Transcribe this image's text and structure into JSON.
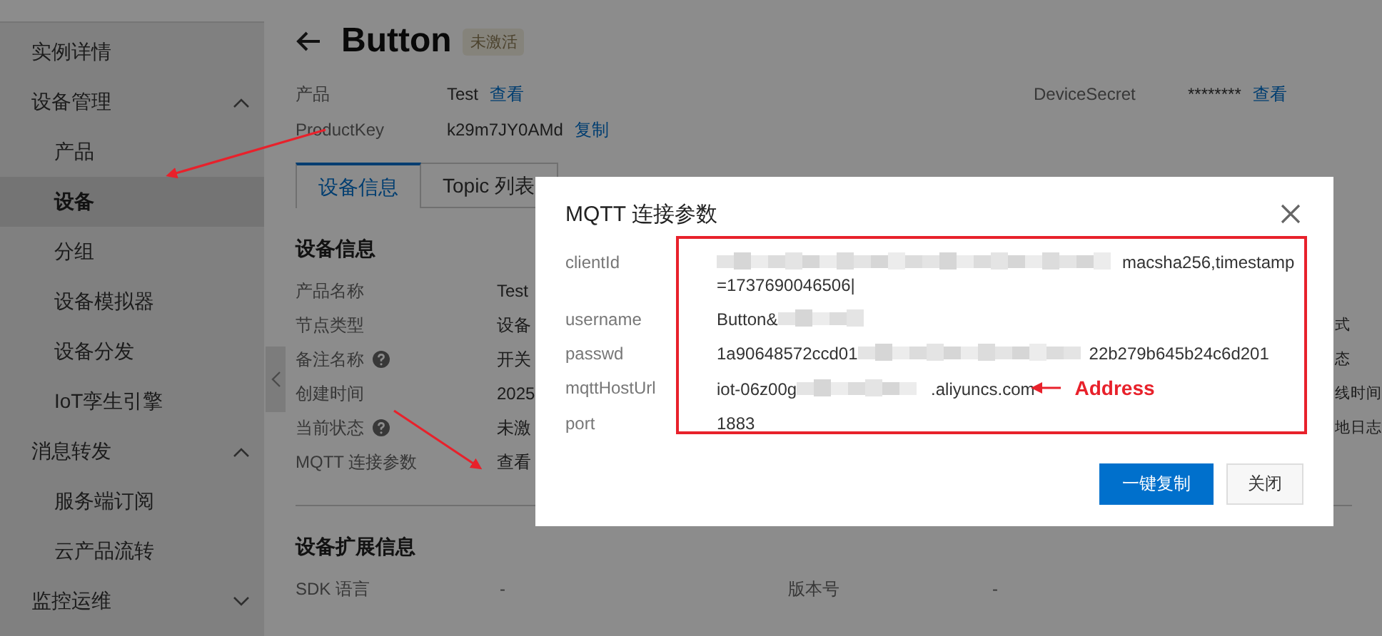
{
  "sidebar": {
    "items": [
      {
        "label": "实例详情",
        "kind": "link",
        "selected": false
      },
      {
        "label": "设备管理",
        "kind": "group",
        "selected": false,
        "expanded": true,
        "children": [
          {
            "label": "产品",
            "selected": false
          },
          {
            "label": "设备",
            "selected": true
          },
          {
            "label": "分组",
            "selected": false
          },
          {
            "label": "设备模拟器",
            "selected": false
          },
          {
            "label": "设备分发",
            "selected": false
          },
          {
            "label": "IoT孪生引擎",
            "selected": false
          }
        ]
      },
      {
        "label": "消息转发",
        "kind": "group",
        "selected": false,
        "expanded": true,
        "children": [
          {
            "label": "服务端订阅",
            "selected": false
          },
          {
            "label": "云产品流转",
            "selected": false
          }
        ]
      },
      {
        "label": "监控运维",
        "kind": "group",
        "selected": false,
        "expanded": false
      }
    ]
  },
  "header": {
    "title": "Button",
    "status": "未激活"
  },
  "summary": [
    {
      "label": "产品",
      "value": "Test",
      "link": "查看"
    },
    {
      "label": "ProductKey",
      "value": "k29m7JY0AMd",
      "link": "复制"
    },
    {
      "label": "DeviceSecret",
      "value": "********",
      "link": "查看"
    }
  ],
  "tabs": [
    {
      "label": "设备信息",
      "selected": true
    },
    {
      "label": "Topic 列表",
      "selected": false
    }
  ],
  "device_info": {
    "title": "设备信息",
    "rows": [
      {
        "label": "产品名称",
        "help": false,
        "value": "Test"
      },
      {
        "label": "节点类型",
        "help": false,
        "value": "设备",
        "side": "式"
      },
      {
        "label": "备注名称",
        "help": true,
        "value": "开关",
        "side": "态"
      },
      {
        "label": "创建时间",
        "help": false,
        "value": "2025",
        "side": "线时间"
      },
      {
        "label": "当前状态",
        "help": true,
        "value": "未激",
        "side": "地日志"
      },
      {
        "label": "MQTT 连接参数",
        "help": false,
        "link": "查看"
      }
    ]
  },
  "extended_info": {
    "title": "设备扩展信息",
    "fields": [
      {
        "label": "SDK 语言",
        "value": "-"
      },
      {
        "label": "版本号",
        "value": "-"
      }
    ]
  },
  "modal": {
    "title": "MQTT 连接参数",
    "fields": [
      {
        "label": "clientId",
        "redacted": true,
        "value_end": "macsha256,timestamp=1737690046506|"
      },
      {
        "label": "username",
        "value_start": "Button&",
        "redacted": true
      },
      {
        "label": "passwd",
        "value_start": "1a90648572ccd01",
        "redacted": true,
        "value_end": "22b279b645b24c6d201"
      },
      {
        "label": "mqttHostUrl",
        "value_start": "iot-06z00g",
        "redacted": true,
        "value_end": ".aliyuncs.com"
      },
      {
        "label": "port",
        "value_start": "1883",
        "redacted": false
      }
    ],
    "buttons": [
      {
        "label": "一键复制",
        "kind": "primary"
      },
      {
        "label": "关闭",
        "kind": "default"
      }
    ],
    "annotation_label": "Address"
  }
}
